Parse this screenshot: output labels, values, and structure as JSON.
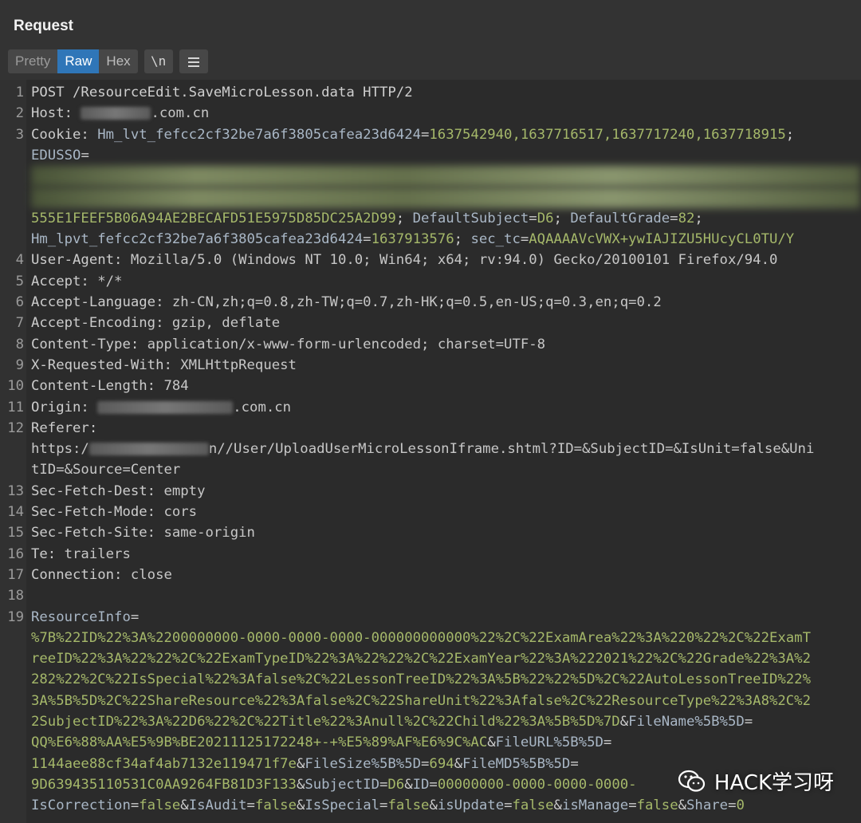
{
  "panel": {
    "title": "Request"
  },
  "toolbar": {
    "pretty": "Pretty",
    "raw": "Raw",
    "hex": "Hex",
    "newline": "\\n",
    "menu_icon": "hamburger-menu-icon"
  },
  "lines": [
    {
      "n": "1",
      "parts": [
        [
          "pre",
          "POST /ResourceEdit.SaveMicroLesson.data HTTP/2"
        ]
      ]
    },
    {
      "n": "2",
      "parts": [
        [
          "hdr",
          "Host: "
        ],
        [
          "blur",
          ""
        ],
        [
          "val",
          ".com.cn"
        ]
      ]
    },
    {
      "n": "3",
      "parts": [
        [
          "hdr",
          "Cookie: "
        ],
        [
          "k",
          "Hm_lvt_fefcc2cf32be7a6f3805cafea23d6424"
        ],
        [
          "hdr",
          "="
        ],
        [
          "g",
          "1637542940,1637716517,1637717240,1637718915"
        ],
        [
          "hdr",
          ";"
        ]
      ]
    },
    {
      "n": "",
      "parts": [
        [
          "k",
          "EDUSSO"
        ],
        [
          "hdr",
          "="
        ]
      ]
    },
    {
      "n": "",
      "parts": [
        [
          "band",
          ""
        ]
      ]
    },
    {
      "n": "",
      "parts": [
        [
          "band",
          ""
        ]
      ]
    },
    {
      "n": "",
      "parts": [
        [
          "g",
          "555E1FEEF5B06A94AE2BECAFD51E5975D85DC25A2D99"
        ],
        [
          "hdr",
          "; "
        ],
        [
          "k",
          "DefaultSubject"
        ],
        [
          "hdr",
          "="
        ],
        [
          "g",
          "D6"
        ],
        [
          "hdr",
          "; "
        ],
        [
          "k",
          "DefaultGrade"
        ],
        [
          "hdr",
          "="
        ],
        [
          "g",
          "82"
        ],
        [
          "hdr",
          ";"
        ]
      ]
    },
    {
      "n": "",
      "parts": [
        [
          "k",
          "Hm_lpvt_fefcc2cf32be7a6f3805cafea23d6424"
        ],
        [
          "hdr",
          "="
        ],
        [
          "g",
          "1637913576"
        ],
        [
          "hdr",
          "; "
        ],
        [
          "k",
          "sec_tc"
        ],
        [
          "hdr",
          "="
        ],
        [
          "g",
          "AQAAAAVcVWX+ywIAJIZU5HUcyCL0TU/Y"
        ]
      ]
    },
    {
      "n": "4",
      "parts": [
        [
          "hdr",
          "User-Agent: "
        ],
        [
          "val",
          "Mozilla/5.0 (Windows NT 10.0; Win64; x64; rv:94.0) Gecko/20100101 Firefox/94.0"
        ]
      ]
    },
    {
      "n": "5",
      "parts": [
        [
          "hdr",
          "Accept: "
        ],
        [
          "val",
          "*/*"
        ]
      ]
    },
    {
      "n": "6",
      "parts": [
        [
          "hdr",
          "Accept-Language: "
        ],
        [
          "val",
          "zh-CN,zh;q=0.8,zh-TW;q=0.7,zh-HK;q=0.5,en-US;q=0.3,en;q=0.2"
        ]
      ]
    },
    {
      "n": "7",
      "parts": [
        [
          "hdr",
          "Accept-Encoding: "
        ],
        [
          "val",
          "gzip, deflate"
        ]
      ]
    },
    {
      "n": "8",
      "parts": [
        [
          "hdr",
          "Content-Type: "
        ],
        [
          "val",
          "application/x-www-form-urlencoded; charset=UTF-8"
        ]
      ]
    },
    {
      "n": "9",
      "parts": [
        [
          "hdr",
          "X-Requested-With: "
        ],
        [
          "val",
          "XMLHttpRequest"
        ]
      ]
    },
    {
      "n": "10",
      "parts": [
        [
          "hdr",
          "Content-Length: "
        ],
        [
          "val",
          "784"
        ]
      ]
    },
    {
      "n": "11",
      "parts": [
        [
          "hdr",
          "Origin: "
        ],
        [
          "blur",
          ""
        ],
        [
          "val",
          ".com.cn"
        ]
      ]
    },
    {
      "n": "12",
      "parts": [
        [
          "hdr",
          "Referer:"
        ]
      ]
    },
    {
      "n": "",
      "parts": [
        [
          "val",
          "https:/"
        ],
        [
          "blur",
          ""
        ],
        [
          "val",
          "n//User/UploadUserMicroLessonIframe.shtml?ID=&SubjectID=&IsUnit=false&Uni"
        ]
      ]
    },
    {
      "n": "",
      "parts": [
        [
          "val",
          "tID=&Source=Center"
        ]
      ]
    },
    {
      "n": "13",
      "parts": [
        [
          "hdr",
          "Sec-Fetch-Dest: "
        ],
        [
          "val",
          "empty"
        ]
      ]
    },
    {
      "n": "14",
      "parts": [
        [
          "hdr",
          "Sec-Fetch-Mode: "
        ],
        [
          "val",
          "cors"
        ]
      ]
    },
    {
      "n": "15",
      "parts": [
        [
          "hdr",
          "Sec-Fetch-Site: "
        ],
        [
          "val",
          "same-origin"
        ]
      ]
    },
    {
      "n": "16",
      "parts": [
        [
          "hdr",
          "Te: "
        ],
        [
          "val",
          "trailers"
        ]
      ]
    },
    {
      "n": "17",
      "parts": [
        [
          "hdr",
          "Connection: "
        ],
        [
          "val",
          "close"
        ]
      ]
    },
    {
      "n": "18",
      "parts": []
    },
    {
      "n": "19",
      "parts": [
        [
          "k",
          "ResourceInfo"
        ],
        [
          "hdr",
          "="
        ]
      ]
    },
    {
      "n": "",
      "parts": [
        [
          "g",
          "%7B%22ID%22%3A%2200000000-0000-0000-0000-000000000000%22%2C%22ExamArea%22%3A%220%22%2C%22ExamT"
        ]
      ]
    },
    {
      "n": "",
      "parts": [
        [
          "g",
          "reeID%22%3A%22%22%2C%22ExamTypeID%22%3A%22%22%2C%22ExamYear%22%3A%222021%22%2C%22Grade%22%3A%2"
        ]
      ]
    },
    {
      "n": "",
      "parts": [
        [
          "g",
          "282%22%2C%22IsSpecial%22%3Afalse%2C%22LessonTreeID%22%3A%5B%22%22%5D%2C%22AutoLessonTreeID%22%"
        ]
      ]
    },
    {
      "n": "",
      "parts": [
        [
          "g",
          "3A%5B%5D%2C%22ShareResource%22%3Afalse%2C%22ShareUnit%22%3Afalse%2C%22ResourceType%22%3A8%2C%2"
        ]
      ]
    },
    {
      "n": "",
      "parts": [
        [
          "g",
          "2SubjectID%22%3A%22D6%22%2C%22Title%22%3Anull%2C%22Child%22%3A%5B%5D%7D"
        ],
        [
          "hdr",
          "&"
        ],
        [
          "k",
          "FileName%5B%5D"
        ],
        [
          "hdr",
          "="
        ]
      ]
    },
    {
      "n": "",
      "parts": [
        [
          "g",
          "QQ%E6%88%AA%E5%9B%BE20211125172248+-+%E5%89%AF%E6%9C%AC"
        ],
        [
          "hdr",
          "&"
        ],
        [
          "k",
          "FileURL%5B%5D"
        ],
        [
          "hdr",
          "="
        ]
      ]
    },
    {
      "n": "",
      "parts": [
        [
          "g",
          "1144aee88cf34af4ab7132e119471f7e"
        ],
        [
          "hdr",
          "&"
        ],
        [
          "k",
          "FileSize%5B%5D"
        ],
        [
          "hdr",
          "="
        ],
        [
          "g",
          "694"
        ],
        [
          "hdr",
          "&"
        ],
        [
          "k",
          "FileMD5%5B%5D"
        ],
        [
          "hdr",
          "="
        ]
      ]
    },
    {
      "n": "",
      "parts": [
        [
          "g",
          "9D639435110531C0AA9264FB81D3F133"
        ],
        [
          "hdr",
          "&"
        ],
        [
          "k",
          "SubjectID"
        ],
        [
          "hdr",
          "="
        ],
        [
          "g",
          "D6"
        ],
        [
          "hdr",
          "&"
        ],
        [
          "k",
          "ID"
        ],
        [
          "hdr",
          "="
        ],
        [
          "g",
          "00000000-0000-0000-0000-"
        ]
      ]
    },
    {
      "n": "",
      "parts": [
        [
          "k",
          "IsCorrection"
        ],
        [
          "hdr",
          "="
        ],
        [
          "g",
          "false"
        ],
        [
          "hdr",
          "&"
        ],
        [
          "k",
          "IsAudit"
        ],
        [
          "hdr",
          "="
        ],
        [
          "g",
          "false"
        ],
        [
          "hdr",
          "&"
        ],
        [
          "k",
          "IsSpecial"
        ],
        [
          "hdr",
          "="
        ],
        [
          "g",
          "false"
        ],
        [
          "hdr",
          "&"
        ],
        [
          "k",
          "isUpdate"
        ],
        [
          "hdr",
          "="
        ],
        [
          "g",
          "false"
        ],
        [
          "hdr",
          "&"
        ],
        [
          "k",
          "isManage"
        ],
        [
          "hdr",
          "="
        ],
        [
          "g",
          "false"
        ],
        [
          "hdr",
          "&"
        ],
        [
          "k",
          "Share"
        ],
        [
          "hdr",
          "="
        ],
        [
          "g",
          "0"
        ]
      ]
    }
  ],
  "watermark": {
    "text": "HACK学习呀",
    "icon": "wechat-icon"
  }
}
